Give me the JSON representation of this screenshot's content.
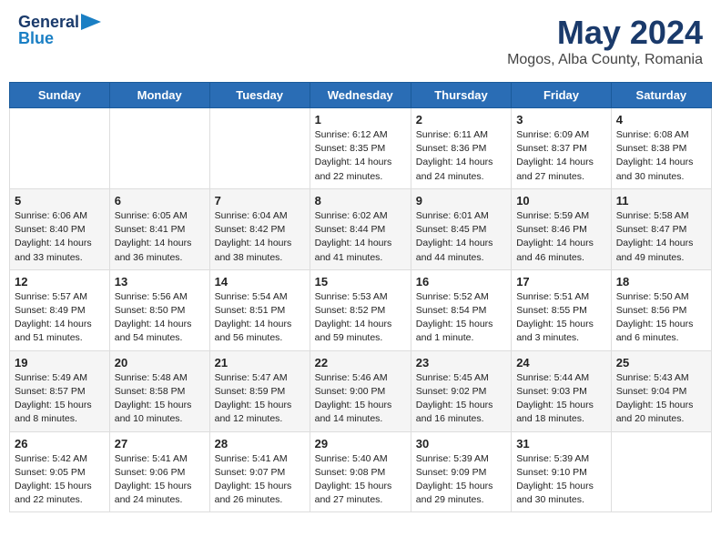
{
  "header": {
    "logo_general": "General",
    "logo_blue": "Blue",
    "title": "May 2024",
    "subtitle": "Mogos, Alba County, Romania"
  },
  "weekdays": [
    "Sunday",
    "Monday",
    "Tuesday",
    "Wednesday",
    "Thursday",
    "Friday",
    "Saturday"
  ],
  "weeks": [
    [
      {
        "day": "",
        "info": ""
      },
      {
        "day": "",
        "info": ""
      },
      {
        "day": "",
        "info": ""
      },
      {
        "day": "1",
        "info": "Sunrise: 6:12 AM\nSunset: 8:35 PM\nDaylight: 14 hours and 22 minutes."
      },
      {
        "day": "2",
        "info": "Sunrise: 6:11 AM\nSunset: 8:36 PM\nDaylight: 14 hours and 24 minutes."
      },
      {
        "day": "3",
        "info": "Sunrise: 6:09 AM\nSunset: 8:37 PM\nDaylight: 14 hours and 27 minutes."
      },
      {
        "day": "4",
        "info": "Sunrise: 6:08 AM\nSunset: 8:38 PM\nDaylight: 14 hours and 30 minutes."
      }
    ],
    [
      {
        "day": "5",
        "info": "Sunrise: 6:06 AM\nSunset: 8:40 PM\nDaylight: 14 hours and 33 minutes."
      },
      {
        "day": "6",
        "info": "Sunrise: 6:05 AM\nSunset: 8:41 PM\nDaylight: 14 hours and 36 minutes."
      },
      {
        "day": "7",
        "info": "Sunrise: 6:04 AM\nSunset: 8:42 PM\nDaylight: 14 hours and 38 minutes."
      },
      {
        "day": "8",
        "info": "Sunrise: 6:02 AM\nSunset: 8:44 PM\nDaylight: 14 hours and 41 minutes."
      },
      {
        "day": "9",
        "info": "Sunrise: 6:01 AM\nSunset: 8:45 PM\nDaylight: 14 hours and 44 minutes."
      },
      {
        "day": "10",
        "info": "Sunrise: 5:59 AM\nSunset: 8:46 PM\nDaylight: 14 hours and 46 minutes."
      },
      {
        "day": "11",
        "info": "Sunrise: 5:58 AM\nSunset: 8:47 PM\nDaylight: 14 hours and 49 minutes."
      }
    ],
    [
      {
        "day": "12",
        "info": "Sunrise: 5:57 AM\nSunset: 8:49 PM\nDaylight: 14 hours and 51 minutes."
      },
      {
        "day": "13",
        "info": "Sunrise: 5:56 AM\nSunset: 8:50 PM\nDaylight: 14 hours and 54 minutes."
      },
      {
        "day": "14",
        "info": "Sunrise: 5:54 AM\nSunset: 8:51 PM\nDaylight: 14 hours and 56 minutes."
      },
      {
        "day": "15",
        "info": "Sunrise: 5:53 AM\nSunset: 8:52 PM\nDaylight: 14 hours and 59 minutes."
      },
      {
        "day": "16",
        "info": "Sunrise: 5:52 AM\nSunset: 8:54 PM\nDaylight: 15 hours and 1 minute."
      },
      {
        "day": "17",
        "info": "Sunrise: 5:51 AM\nSunset: 8:55 PM\nDaylight: 15 hours and 3 minutes."
      },
      {
        "day": "18",
        "info": "Sunrise: 5:50 AM\nSunset: 8:56 PM\nDaylight: 15 hours and 6 minutes."
      }
    ],
    [
      {
        "day": "19",
        "info": "Sunrise: 5:49 AM\nSunset: 8:57 PM\nDaylight: 15 hours and 8 minutes."
      },
      {
        "day": "20",
        "info": "Sunrise: 5:48 AM\nSunset: 8:58 PM\nDaylight: 15 hours and 10 minutes."
      },
      {
        "day": "21",
        "info": "Sunrise: 5:47 AM\nSunset: 8:59 PM\nDaylight: 15 hours and 12 minutes."
      },
      {
        "day": "22",
        "info": "Sunrise: 5:46 AM\nSunset: 9:00 PM\nDaylight: 15 hours and 14 minutes."
      },
      {
        "day": "23",
        "info": "Sunrise: 5:45 AM\nSunset: 9:02 PM\nDaylight: 15 hours and 16 minutes."
      },
      {
        "day": "24",
        "info": "Sunrise: 5:44 AM\nSunset: 9:03 PM\nDaylight: 15 hours and 18 minutes."
      },
      {
        "day": "25",
        "info": "Sunrise: 5:43 AM\nSunset: 9:04 PM\nDaylight: 15 hours and 20 minutes."
      }
    ],
    [
      {
        "day": "26",
        "info": "Sunrise: 5:42 AM\nSunset: 9:05 PM\nDaylight: 15 hours and 22 minutes."
      },
      {
        "day": "27",
        "info": "Sunrise: 5:41 AM\nSunset: 9:06 PM\nDaylight: 15 hours and 24 minutes."
      },
      {
        "day": "28",
        "info": "Sunrise: 5:41 AM\nSunset: 9:07 PM\nDaylight: 15 hours and 26 minutes."
      },
      {
        "day": "29",
        "info": "Sunrise: 5:40 AM\nSunset: 9:08 PM\nDaylight: 15 hours and 27 minutes."
      },
      {
        "day": "30",
        "info": "Sunrise: 5:39 AM\nSunset: 9:09 PM\nDaylight: 15 hours and 29 minutes."
      },
      {
        "day": "31",
        "info": "Sunrise: 5:39 AM\nSunset: 9:10 PM\nDaylight: 15 hours and 30 minutes."
      },
      {
        "day": "",
        "info": ""
      }
    ]
  ]
}
